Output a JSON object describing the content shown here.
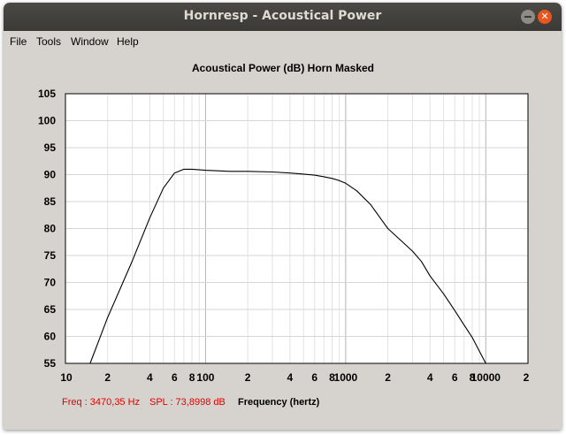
{
  "window": {
    "title": "Hornresp - Acoustical Power",
    "buttons": {
      "minimize_icon": "minimize-icon",
      "close_icon": "close-icon",
      "close_color": "#e9541f"
    }
  },
  "menu": [
    {
      "label": "File"
    },
    {
      "label": "Tools"
    },
    {
      "label": "Window"
    },
    {
      "label": "Help"
    }
  ],
  "chart_title": "Acoustical Power (dB)   Horn   Masked",
  "status": {
    "freq": "Freq : 3470,35 Hz",
    "spl": "SPL : 73,8998 dB",
    "axis_label": "Frequency (hertz)",
    "readout_color": "#e00000"
  },
  "chart_data": {
    "type": "line",
    "title": "Acoustical Power (dB)   Horn   Masked",
    "xlabel": "Frequency (hertz)",
    "ylabel": "",
    "xscale": "log",
    "xlim": [
      10,
      20000
    ],
    "ylim": [
      55,
      105
    ],
    "grid": true,
    "y_ticks": [
      "105",
      "100",
      "95",
      "90",
      "85",
      "80",
      "75",
      "70",
      "65",
      "60",
      "55"
    ],
    "x_ticks": [
      "10",
      "2",
      "4",
      "6",
      "8",
      "100",
      "2",
      "4",
      "6",
      "8",
      "1000",
      "2",
      "4",
      "6",
      "8",
      "10000",
      "2"
    ],
    "series": [
      {
        "x": [
          15,
          20,
          30,
          40,
          50,
          60,
          70,
          80,
          100,
          150,
          200,
          300,
          400,
          500,
          600,
          700,
          800,
          900,
          1000,
          1200,
          1500,
          2000,
          3000,
          3470,
          4000,
          5000,
          6000,
          7000,
          8000,
          10000
        ],
        "y": [
          55,
          63.5,
          74,
          82,
          87.5,
          90.3,
          91,
          91,
          90.8,
          90.6,
          90.6,
          90.5,
          90.3,
          90.1,
          89.9,
          89.6,
          89.3,
          88.9,
          88.4,
          87.0,
          84.5,
          80.0,
          75.8,
          73.9,
          71.2,
          67.9,
          64.8,
          62.1,
          59.8,
          55
        ]
      }
    ]
  }
}
